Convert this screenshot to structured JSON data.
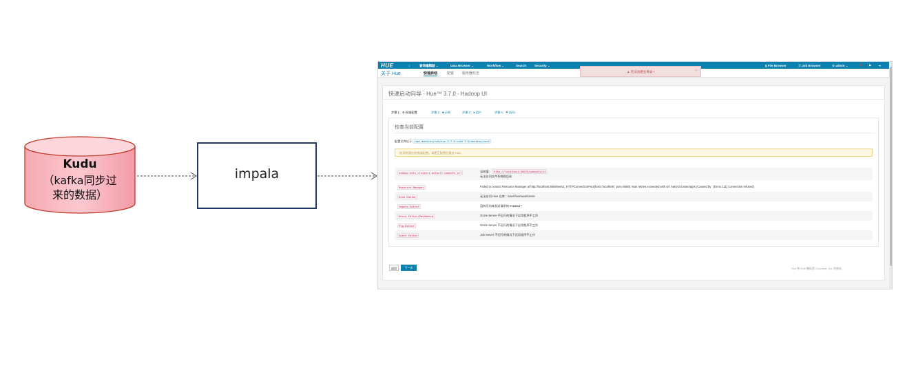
{
  "diagram": {
    "db_title": "Kudu",
    "db_sub_line1": "（kafka同步过",
    "db_sub_line2": "来的数据）",
    "box_label": "impala"
  },
  "hue": {
    "topbar": {
      "logo": "HUE",
      "home": "⌂",
      "query_editors": "查询编辑器 ⌄",
      "data_browser": "Data Browser ⌄",
      "workflow": "Workflow ⌄",
      "search": "Search",
      "security": "Security ⌄",
      "file_browser": "▮ File Browser",
      "job_browser": "☰ Job Browser",
      "admin": "⚙ admin ⌄",
      "help": "❓",
      "flag": "⚑",
      "logout": "⇥"
    },
    "alert": {
      "text": "▲ 无法创建主目录 •",
      "close": "×"
    },
    "subnav": {
      "app": "关于 Hue",
      "tabs": [
        "快速启动",
        "配置",
        "服务器日志"
      ]
    },
    "page_title": "快速启动向导 - Hue™ 3.7.0 - Hadoop UI",
    "steps": [
      "步骤 1：⚙ 检查配置",
      "步骤 2：■ 示例",
      "步骤 3：● 用户",
      "步骤 4：⚑ 执行!"
    ],
    "section_title": "检查当前配置",
    "config_label": "配置文件位于",
    "config_path": "/opt/modules/cdh/hue-3.7.0-cdh5.3.6/desktop/conf",
    "warning": "检测到潜在的错误配置。请更正配置后重启 Hue。",
    "checks": [
      {
        "key": "hadoop.hdfs_clusters.default.webhdfs_url",
        "value": "当前值：",
        "value_code": "http://localhost:50070/webhdfs/v1",
        "note": "无法访问文件系统根目录"
      },
      {
        "key": "Resource Manager",
        "value": "Failed to contact Resource Manager at http://localhost:8088/ws/v1: HTTPConnectionPool(host='localhost', port=8088): Max retries exceeded with url: /ws/v1/cluster/apps (Caused by : [Errno 111] Connection refused)"
      },
      {
        "key": "Hive Editor",
        "value": "无法访问 Hive 仓库：/user/hive/warehouse"
      },
      {
        "key": "Impala Editor",
        "value": "没有可向其发送请求的 Impalad •"
      },
      {
        "key": "Oozie Editor/Dashboard",
        "value": "Oozie Server 不运行的情况下运用程序不工作"
      },
      {
        "key": "Pig Editor",
        "value": "Oozie Server 不运行的情况下运用程序不工作"
      },
      {
        "key": "Spark Editor",
        "value": "Job Server 不运行的情况下运用程序不工作"
      }
    ],
    "back_label": "返回",
    "next_label": "下一步",
    "footer": "Hue 和 Hue 徽标是 Cloudera, Inc. 的商标"
  }
}
